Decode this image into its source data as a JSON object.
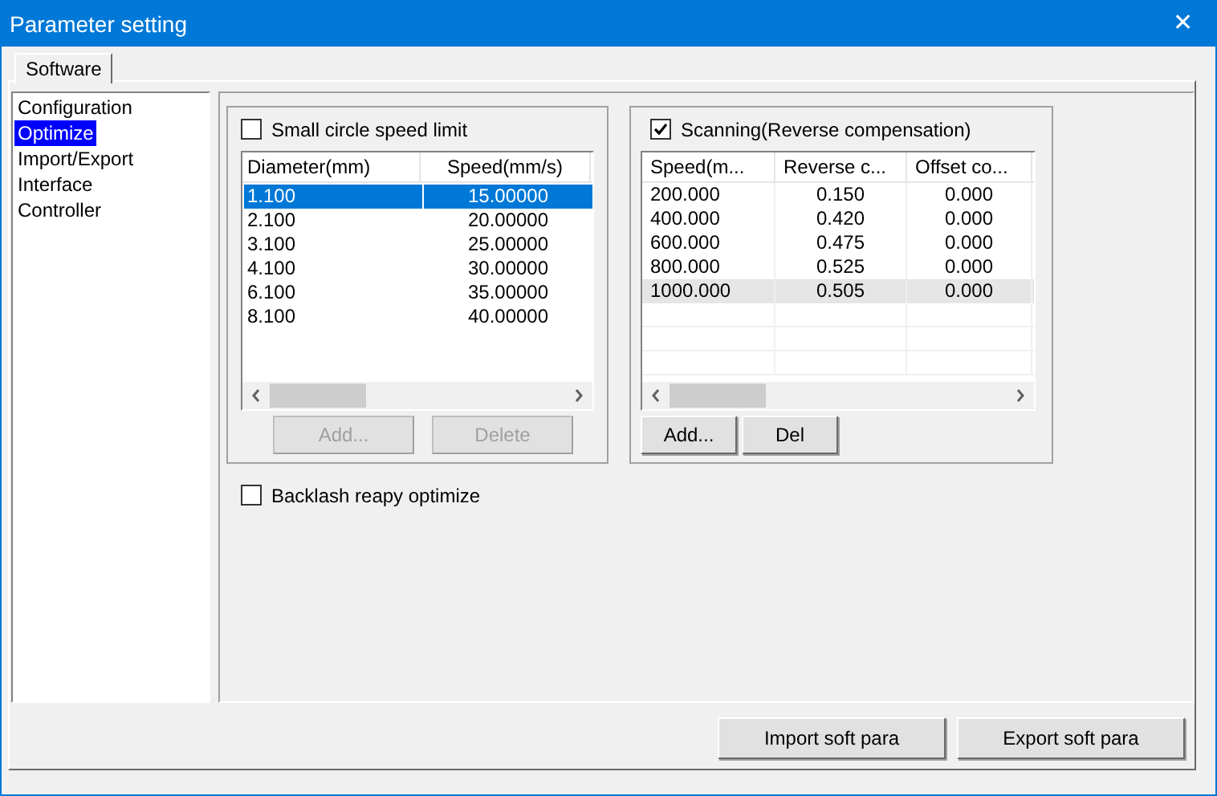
{
  "window": {
    "title": "Parameter setting",
    "close": "✕"
  },
  "tabs": [
    {
      "label": "Software",
      "selected": true
    }
  ],
  "sidebar": {
    "items": [
      {
        "label": "Configuration",
        "selected": false
      },
      {
        "label": "Optimize",
        "selected": true
      },
      {
        "label": "Import/Export",
        "selected": false
      },
      {
        "label": "Interface",
        "selected": false
      },
      {
        "label": "Controller",
        "selected": false
      }
    ]
  },
  "small_circle": {
    "label": "Small circle speed limit",
    "checked": false,
    "columns": [
      "Diameter(mm)",
      "Speed(mm/s)"
    ],
    "rows": [
      {
        "cells": [
          "1.100",
          "15.00000"
        ],
        "selected": true
      },
      {
        "cells": [
          "2.100",
          "20.00000"
        ],
        "selected": false
      },
      {
        "cells": [
          "3.100",
          "25.00000"
        ],
        "selected": false
      },
      {
        "cells": [
          "4.100",
          "30.00000"
        ],
        "selected": false
      },
      {
        "cells": [
          "6.100",
          "35.00000"
        ],
        "selected": false
      },
      {
        "cells": [
          "8.100",
          "40.00000"
        ],
        "selected": false
      }
    ],
    "buttons": [
      {
        "label": "Add...",
        "disabled": true
      },
      {
        "label": "Delete",
        "disabled": true
      }
    ]
  },
  "scanning": {
    "label": "Scanning(Reverse compensation)",
    "checked": true,
    "columns": [
      "Speed(m...",
      "Reverse c...",
      "Offset co..."
    ],
    "rows": [
      {
        "cells": [
          "200.000",
          "0.150",
          "0.000"
        ],
        "hovered": false
      },
      {
        "cells": [
          "400.000",
          "0.420",
          "0.000"
        ],
        "hovered": false
      },
      {
        "cells": [
          "600.000",
          "0.475",
          "0.000"
        ],
        "hovered": false
      },
      {
        "cells": [
          "800.000",
          "0.525",
          "0.000"
        ],
        "hovered": false
      },
      {
        "cells": [
          "1000.000",
          "0.505",
          "0.000"
        ],
        "hovered": true
      }
    ],
    "buttons": [
      {
        "label": "Add...",
        "disabled": false
      },
      {
        "label": "Del",
        "disabled": false
      }
    ]
  },
  "backlash": {
    "label": "Backlash reapy optimize",
    "checked": false
  },
  "footer_buttons": [
    "Import soft para",
    "Export soft para"
  ]
}
